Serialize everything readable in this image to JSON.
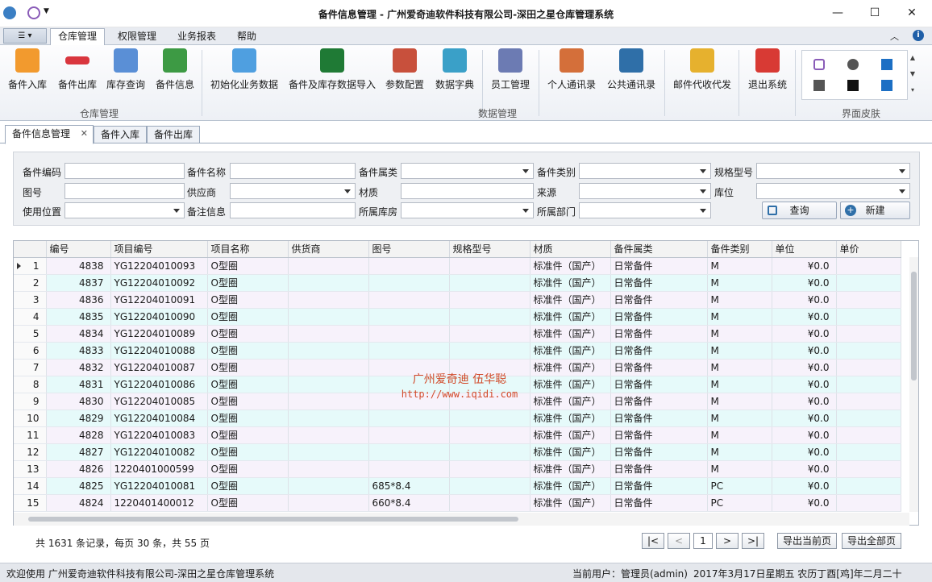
{
  "window": {
    "title": "备件信息管理 - 广州爱奇迪软件科技有限公司-深田之星仓库管理系统",
    "minimize": "—",
    "maximize": "☐",
    "close": "✕"
  },
  "menu": {
    "tabs": [
      "仓库管理",
      "权限管理",
      "业务报表",
      "帮助"
    ]
  },
  "ribbon": {
    "groups": [
      {
        "label": "仓库管理"
      },
      {
        "label": "数据管理"
      },
      {
        "label": "界面皮肤"
      }
    ],
    "buttons": [
      {
        "label": "备件入库",
        "icon": "plus-icon",
        "color": "#f29a2e"
      },
      {
        "label": "备件出库",
        "icon": "minus-icon",
        "color": "#d9363e"
      },
      {
        "label": "库存查询",
        "icon": "search-doc-icon",
        "color": "#5a8fd6"
      },
      {
        "label": "备件信息",
        "icon": "shapes-icon",
        "color": "#3d9a44"
      },
      {
        "label": "初始化业务数据",
        "icon": "new-doc-icon",
        "color": "#4f9fe0"
      },
      {
        "label": "备件及库存数据导入",
        "icon": "excel-icon",
        "color": "#1f7a35"
      },
      {
        "label": "参数配置",
        "icon": "tools-icon",
        "color": "#c8503c"
      },
      {
        "label": "数据字典",
        "icon": "books-icon",
        "color": "#3aa0c8"
      },
      {
        "label": "员工管理",
        "icon": "id-card-icon",
        "color": "#6c7bb3"
      },
      {
        "label": "个人通讯录",
        "icon": "contact-card-icon",
        "color": "#d46f3a"
      },
      {
        "label": "公共通讯录",
        "icon": "address-book-icon",
        "color": "#2f6fa8"
      },
      {
        "label": "邮件代收代发",
        "icon": "mail-icon",
        "color": "#e6b12e"
      },
      {
        "label": "退出系统",
        "icon": "exit-icon",
        "color": "#d83a34"
      }
    ]
  },
  "doctabs": [
    {
      "label": "备件信息管理",
      "close": "✕"
    },
    {
      "label": "备件入库"
    },
    {
      "label": "备件出库"
    }
  ],
  "filter": {
    "labels": [
      "备件编码",
      "备件名称",
      "备件属类",
      "备件类别",
      "规格型号",
      "图号",
      "供应商",
      "材质",
      "来源",
      "库位",
      "使用位置",
      "备注信息",
      "所属库房",
      "所属部门"
    ],
    "query_button": "查询",
    "new_button": "新建"
  },
  "grid": {
    "columns": [
      "编号",
      "项目编号",
      "项目名称",
      "供货商",
      "图号",
      "规格型号",
      "材质",
      "备件属类",
      "备件类别",
      "单位",
      "单价"
    ],
    "rows": [
      [
        "1",
        "4838",
        "YG12204010093",
        "O型圈",
        "",
        "",
        "",
        "标准件（国产）",
        "日常备件",
        "M",
        "¥0.0"
      ],
      [
        "2",
        "4837",
        "YG12204010092",
        "O型圈",
        "",
        "",
        "",
        "标准件（国产）",
        "日常备件",
        "M",
        "¥0.0"
      ],
      [
        "3",
        "4836",
        "YG12204010091",
        "O型圈",
        "",
        "",
        "",
        "标准件（国产）",
        "日常备件",
        "M",
        "¥0.0"
      ],
      [
        "4",
        "4835",
        "YG12204010090",
        "O型圈",
        "",
        "",
        "",
        "标准件（国产）",
        "日常备件",
        "M",
        "¥0.0"
      ],
      [
        "5",
        "4834",
        "YG12204010089",
        "O型圈",
        "",
        "",
        "",
        "标准件（国产）",
        "日常备件",
        "M",
        "¥0.0"
      ],
      [
        "6",
        "4833",
        "YG12204010088",
        "O型圈",
        "",
        "",
        "",
        "标准件（国产）",
        "日常备件",
        "M",
        "¥0.0"
      ],
      [
        "7",
        "4832",
        "YG12204010087",
        "O型圈",
        "",
        "",
        "",
        "标准件（国产）",
        "日常备件",
        "M",
        "¥0.0"
      ],
      [
        "8",
        "4831",
        "YG12204010086",
        "O型圈",
        "",
        "",
        "",
        "标准件（国产）",
        "日常备件",
        "M",
        "¥0.0"
      ],
      [
        "9",
        "4830",
        "YG12204010085",
        "O型圈",
        "",
        "",
        "",
        "标准件（国产）",
        "日常备件",
        "M",
        "¥0.0"
      ],
      [
        "10",
        "4829",
        "YG12204010084",
        "O型圈",
        "",
        "",
        "",
        "标准件（国产）",
        "日常备件",
        "M",
        "¥0.0"
      ],
      [
        "11",
        "4828",
        "YG12204010083",
        "O型圈",
        "",
        "",
        "",
        "标准件（国产）",
        "日常备件",
        "M",
        "¥0.0"
      ],
      [
        "12",
        "4827",
        "YG12204010082",
        "O型圈",
        "",
        "",
        "",
        "标准件（国产）",
        "日常备件",
        "M",
        "¥0.0"
      ],
      [
        "13",
        "4826",
        "1220401000599",
        "O型圈",
        "",
        "",
        "",
        "标准件（国产）",
        "日常备件",
        "M",
        "¥0.0"
      ],
      [
        "14",
        "4825",
        "YG12204010081",
        "O型圈",
        "",
        "685*8.4",
        "",
        "标准件（国产）",
        "日常备件",
        "PC",
        "¥0.0"
      ],
      [
        "15",
        "4824",
        "1220401400012",
        "O型圈",
        "",
        "660*8.4",
        "",
        "标准件（国产）",
        "日常备件",
        "PC",
        "¥0.0"
      ]
    ]
  },
  "watermark": {
    "line1": "广州爱奇迪 伍华聪",
    "line2": "http://www.iqidi.com"
  },
  "pager": {
    "summary": "共 1631 条记录，每页 30 条，共 55 页",
    "first": "|<",
    "prev": "<",
    "page": "1",
    "next": ">",
    "last": ">|",
    "export_current": "导出当前页",
    "export_all": "导出全部页"
  },
  "status": {
    "welcome": "欢迎使用 广州爱奇迪软件科技有限公司-深田之星仓库管理系统",
    "user": "当前用户：管理员(admin)",
    "date": "2017年3月17日星期五 农历丁酉[鸡]年二月二十"
  }
}
